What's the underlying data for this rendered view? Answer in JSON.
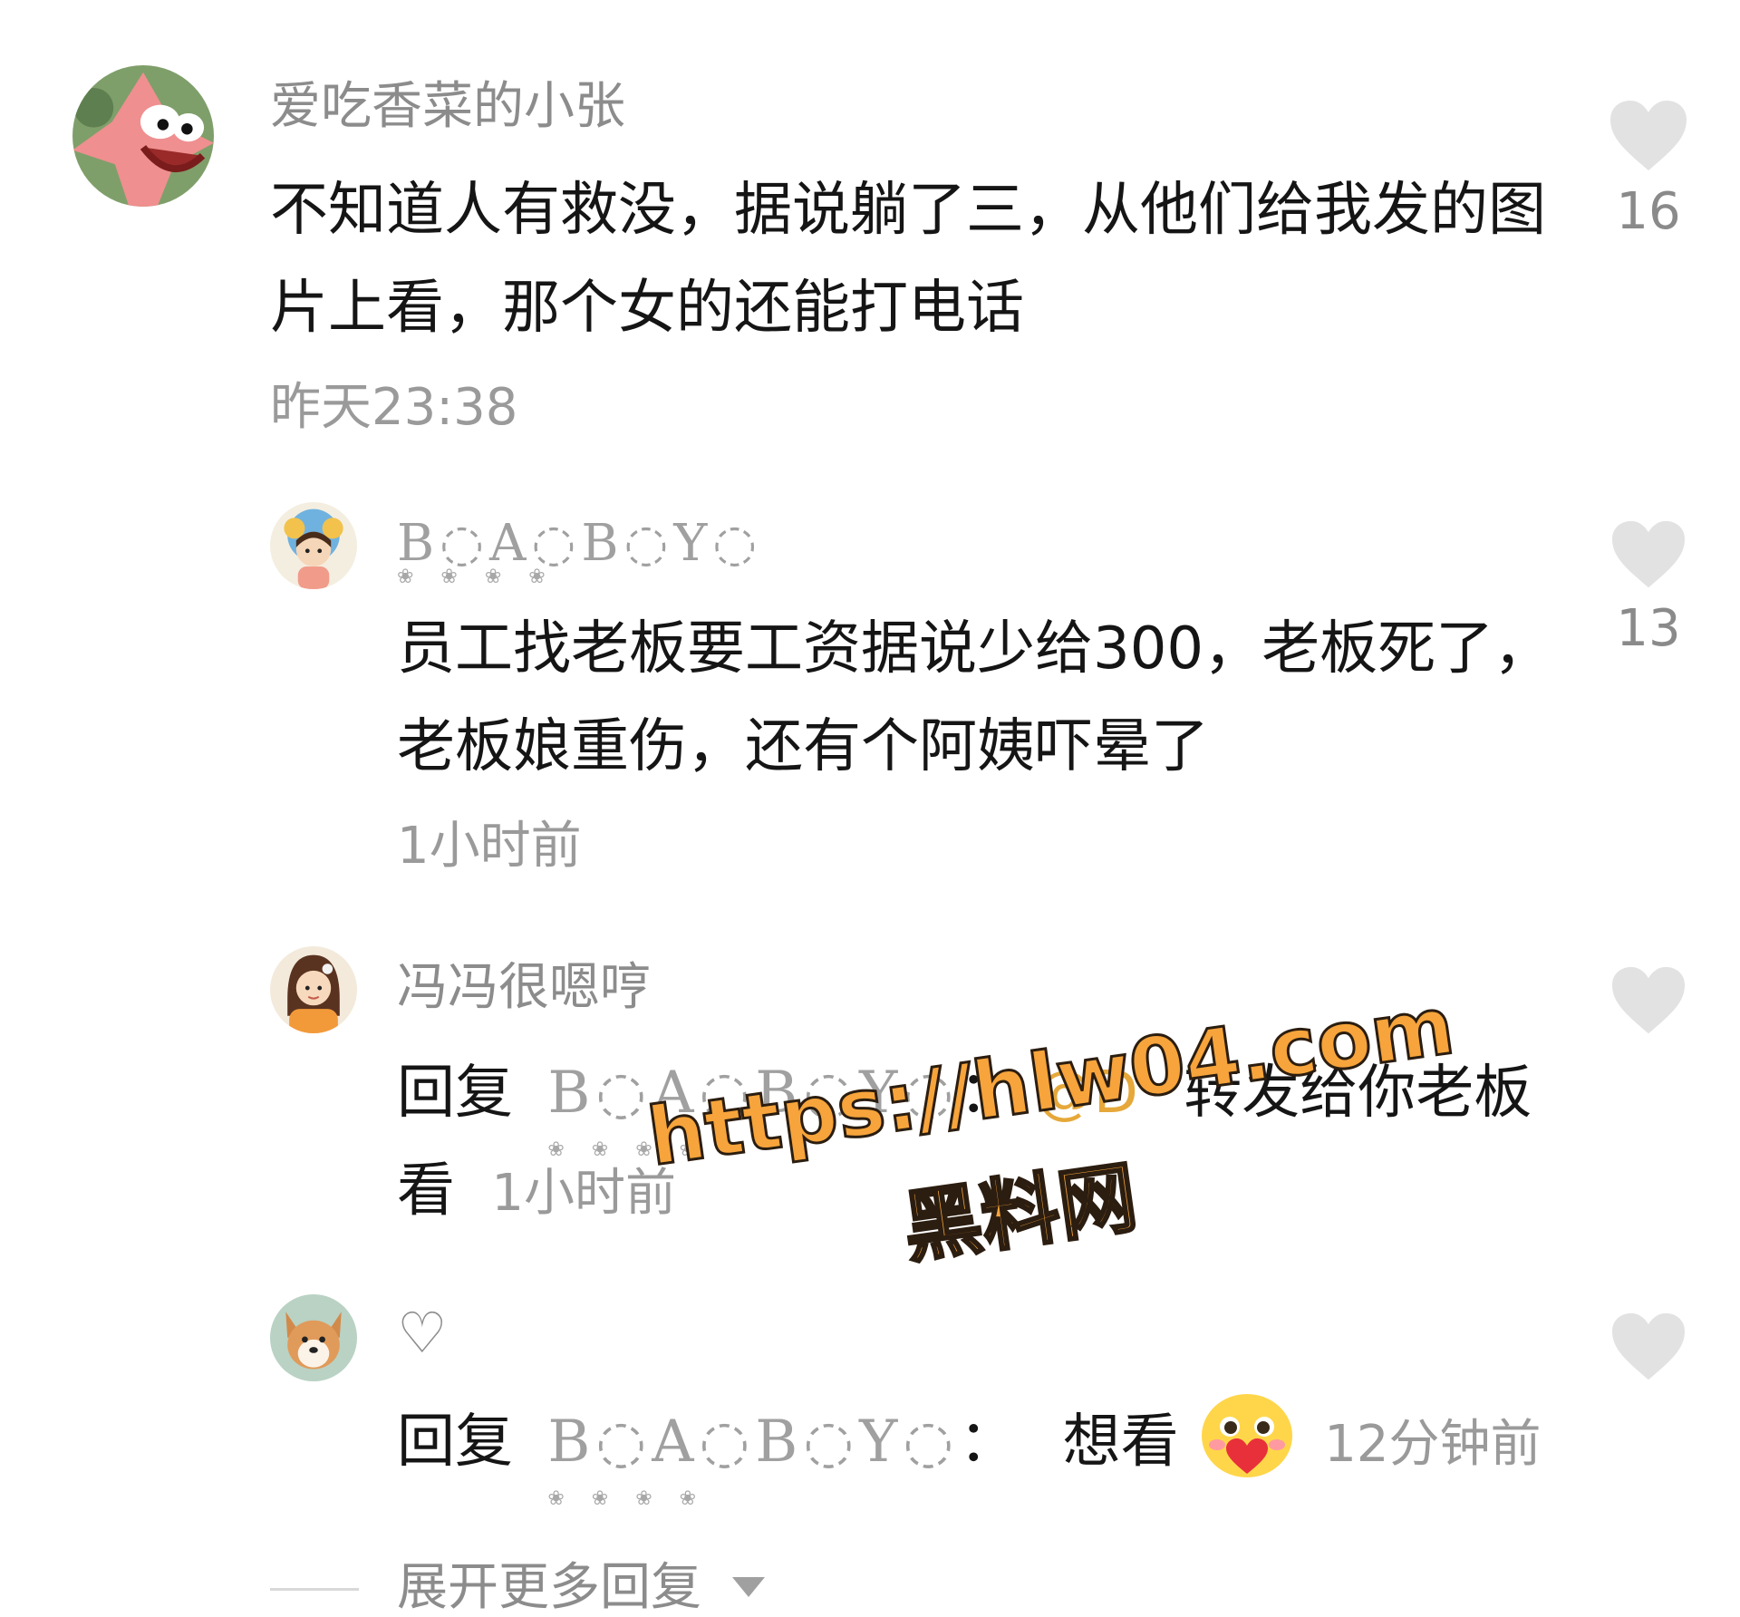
{
  "comments": [
    {
      "username": "爱吃香菜的小张",
      "body": "不知道人有救没，据说躺了三，从他们给我发的图片上看，那个女的还能打电话",
      "timestamp": "昨天23:38",
      "likes": "16",
      "avatar_icon": "patrick-star-avatar"
    },
    {
      "username": "B◌A◌B◌Y◌",
      "body": "员工找老板要工资据说少给300，老板死了，老板娘重伤，还有个阿姨吓晕了",
      "timestamp": "1小时前",
      "likes": "13",
      "avatar_icon": "cartoon-girl-avatar"
    },
    {
      "username": "冯冯很嗯哼",
      "reply_prefix": "回复",
      "reply_to": "B◌A◌B◌Y◌",
      "colon": "：",
      "mention": "@D",
      "body_line1": "转发给你老板",
      "body_line2": "看",
      "timestamp": "1小时前",
      "avatar_icon": "cartoon-girl-orange-avatar"
    },
    {
      "username": "♡",
      "reply_prefix": "回复",
      "reply_to": "B◌A◌B◌Y◌",
      "colon": "：",
      "body": "想看",
      "emoji": "blush-heart-emoji",
      "timestamp": "12分钟前",
      "avatar_icon": "dog-avatar"
    }
  ],
  "expand_replies": "展开更多回复",
  "watermark": {
    "url": "https://hlw04.com",
    "name": "黑料网"
  },
  "colors": {
    "username": "#8c8c8c",
    "body": "#151515",
    "timestamp": "#9a9a9a",
    "heart": "#e2e2e2",
    "mention": "#e6a83a",
    "watermark": "#f6a43b"
  }
}
